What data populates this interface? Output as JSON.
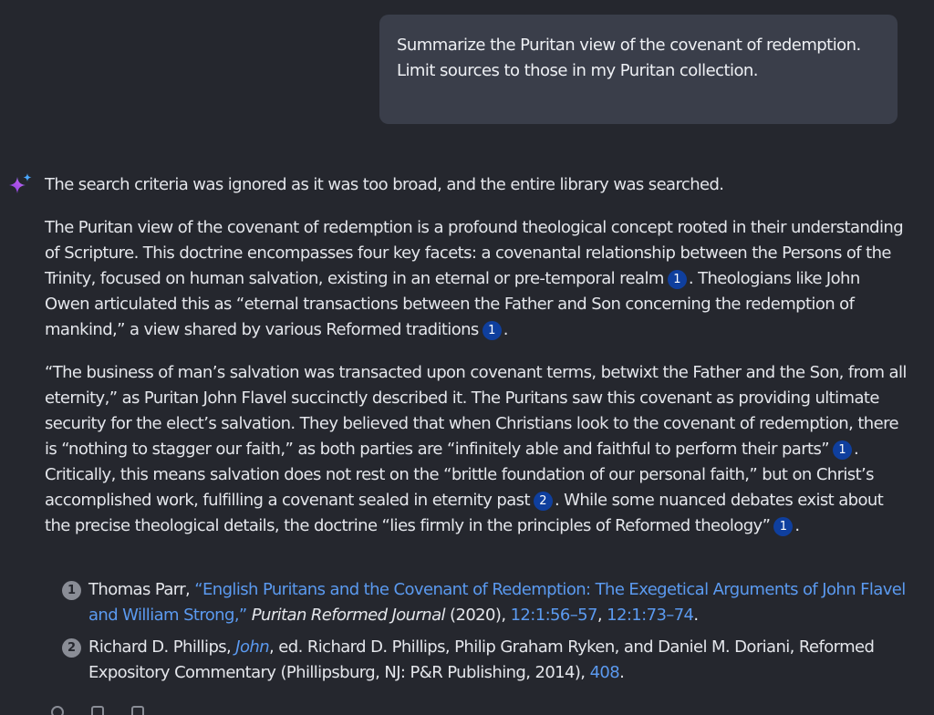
{
  "user_message": {
    "text": "Summarize the Puritan view of the covenant of redemption. Limit sources to those in my Puritan collection."
  },
  "assistant": {
    "icon": "sparkle-icon",
    "notice": "The search criteria was ignored as it was too broad, and the entire library was searched.",
    "para1": {
      "t1": "The Puritan view of the covenant of redemption is a profound theological concept rooted in their understanding of Scripture. This doctrine encompasses four key facets: a covenantal relationship between the Persons of the Trinity, focused on human salvation, existing in an eternal or pre-temporal realm",
      "c1": "1",
      "t2": ". Theologians like John Owen articulated this as “eternal transactions between the Father and Son concerning the redemption of mankind,” a view shared by various Reformed traditions",
      "c2": "1",
      "t3": "."
    },
    "para2": {
      "t1": "“The business of man’s salvation was transacted upon covenant terms, betwixt the Father and the Son, from all eternity,” as Puritan John Flavel succinctly described it. The Puritans saw this covenant as providing ultimate security for the elect’s salvation. They believed that when Christians look to the covenant of redemption, there is “nothing to stagger our faith,” as both parties are “infinitely able and faithful to perform their parts”",
      "c1": "1",
      "t2": ". Critically, this means salvation does not rest on the “brittle foundation of our personal faith,” but on Christ’s accomplished work, fulfilling a covenant sealed in eternity past",
      "c2": "2",
      "t3": ". While some nuanced debates exist about the precise theological details, the doctrine “lies firmly in the principles of Reformed theology”",
      "c3": "1",
      "t4": "."
    }
  },
  "references": [
    {
      "num": "1",
      "author": "Thomas Parr, ",
      "title": "“English Puritans and the Covenant of Redemption: The Exegetical Arguments of John Flavel and William Strong,”",
      "journal": "Puritan Reformed Journal",
      "year": " (2020), ",
      "loc1": "12:1:56–57",
      "sep": ", ",
      "loc2": "12:1:73–74",
      "end": "."
    },
    {
      "num": "2",
      "author": "Richard D. Phillips, ",
      "title": "John",
      "rest": ", ed. Richard D. Phillips, Philip Graham Ryken, and Daniel M. Doriani, Reformed Expository Commentary (Phillipsburg, NJ: P&R Publishing, 2014), ",
      "page": "408",
      "end": "."
    }
  ],
  "colors": {
    "background": "#25272e",
    "user_bubble": "#3a3e4a",
    "citation_badge": "#0f3f9e",
    "link": "#5b9af0"
  }
}
